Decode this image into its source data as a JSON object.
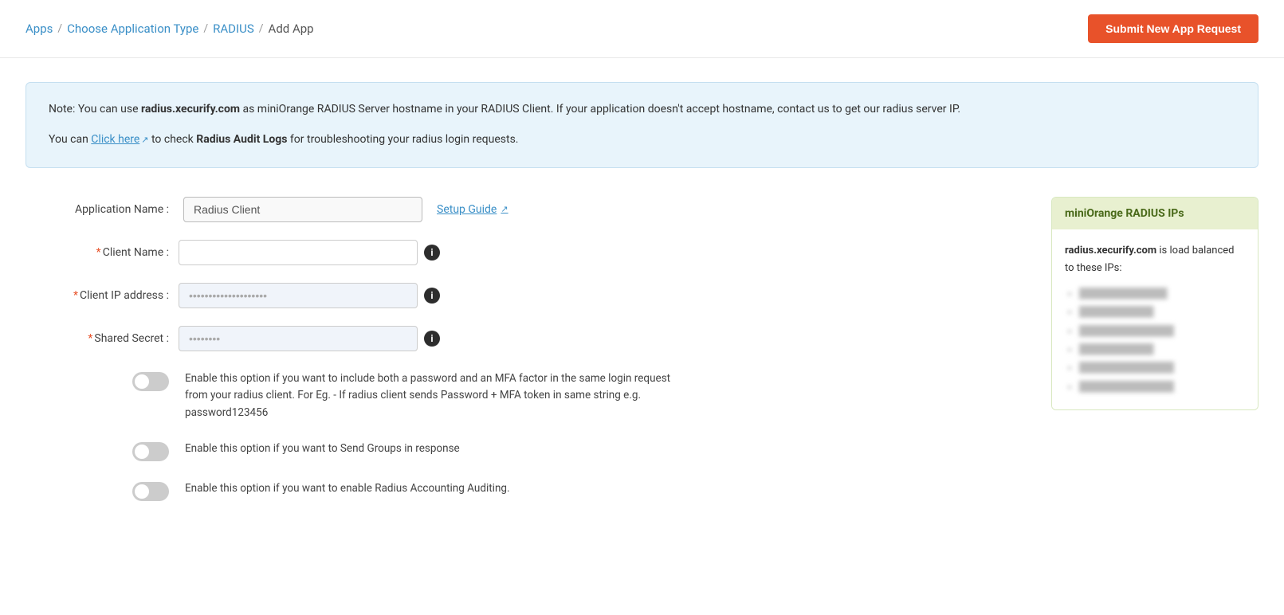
{
  "header": {
    "breadcrumb": {
      "apps": "Apps",
      "choose_app_type": "Choose Application Type",
      "radius": "RADIUS",
      "add_app": "Add App"
    },
    "submit_button": "Submit New App Request"
  },
  "info_box": {
    "line1_prefix": "Note: You can use ",
    "hostname": "radius.xecurify.com",
    "line1_suffix": " as miniOrange RADIUS Server hostname in your RADIUS Client. If your application doesn't accept hostname, contact us to get our radius server IP.",
    "line2_prefix": "You can ",
    "click_here": "Click here",
    "line2_suffix": " to check ",
    "audit_logs": "Radius Audit Logs",
    "line2_end": " for troubleshooting your radius login requests."
  },
  "form": {
    "app_name_label": "Application Name :",
    "app_name_value": "Radius Client",
    "setup_guide": "Setup Guide",
    "client_name_label": "Client Name :",
    "client_name_placeholder": "",
    "client_ip_label": "Client IP address :",
    "client_ip_placeholder": "••••••••••••••••••••••",
    "shared_secret_label": "Shared Secret :",
    "shared_secret_value": "••••••••",
    "toggle1_desc": "Enable this option if you want to include both a password and an MFA factor in the same login request from your radius client. For Eg. - If radius client sends Password + MFA token in same string e.g. password123456",
    "toggle2_desc": "Enable this option if you want to Send Groups in response",
    "toggle3_desc": "Enable this option if you want to enable Radius Accounting Auditing."
  },
  "sidebar": {
    "title": "miniOrange RADIUS IPs",
    "description_prefix": "",
    "hostname_bold": "radius.xecurify.com",
    "description_suffix": " is load balanced to these IPs:",
    "ips": [
      "██████████████",
      "████████████",
      "████████████████",
      "████████████",
      "████████████████",
      "████████████████"
    ]
  }
}
